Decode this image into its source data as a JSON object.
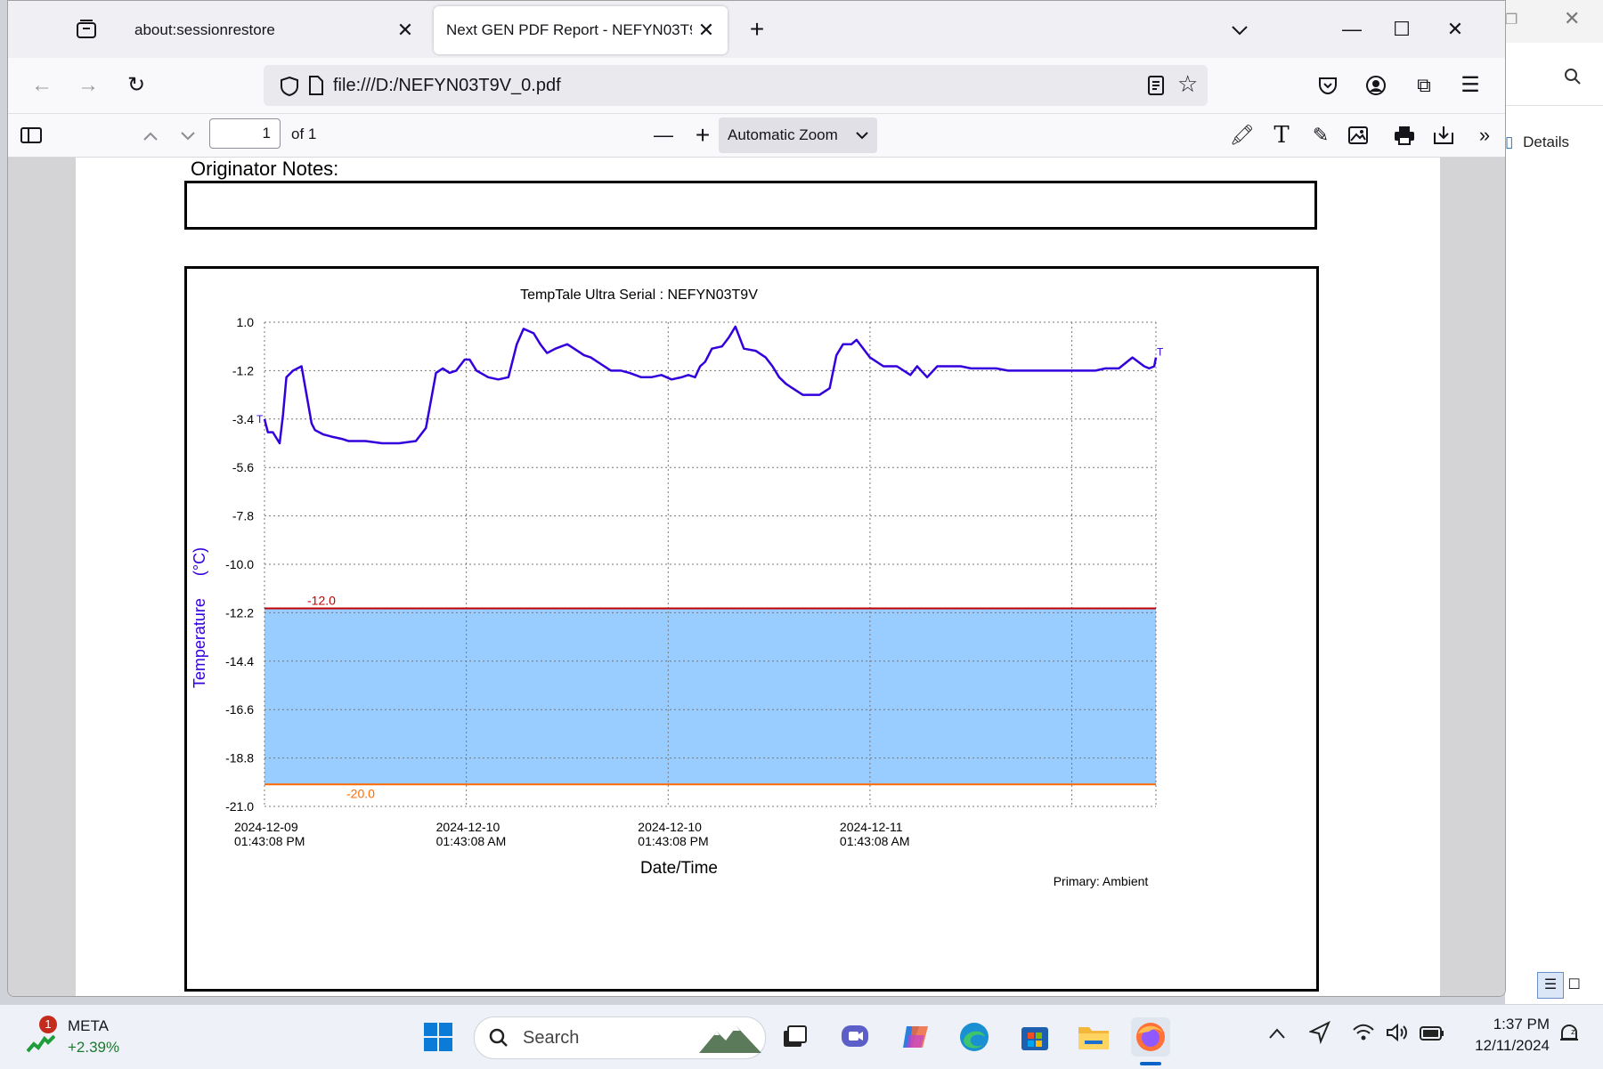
{
  "browser": {
    "tabs": [
      {
        "label": "about:sessionrestore"
      },
      {
        "label": "Next GEN PDF Report - NEFYN03T9V"
      }
    ],
    "url": "file:///D:/NEFYN03T9V_0.pdf"
  },
  "pdf_toolbar": {
    "page_number": "1",
    "page_count": "of 1",
    "zoom": "Automatic Zoom"
  },
  "background_window": {
    "details_label": "Details"
  },
  "report": {
    "notes_label": "Originator Notes:"
  },
  "chart_data": {
    "type": "line",
    "title": "TempTale Ultra  Serial : NEFYN03T9V",
    "ylabel": "Temperature     (°C)",
    "xlabel": "Date/Time",
    "ylim": [
      -21.0,
      1.0
    ],
    "yticks": [
      "1.0",
      "-1.2",
      "-3.4",
      "-5.6",
      "-7.8",
      "-10.0",
      "-12.2",
      "-14.4",
      "-16.6",
      "-18.8",
      "-21.0"
    ],
    "xticks": [
      {
        "date": "2024-12-09",
        "time": "01:43:08 PM"
      },
      {
        "date": "2024-12-10",
        "time": "01:43:08 AM"
      },
      {
        "date": "2024-12-10",
        "time": "01:43:08 PM"
      },
      {
        "date": "2024-12-11",
        "time": "01:43:08 AM"
      }
    ],
    "x_hours_per_grid": 12,
    "x_range_hours": [
      0,
      53
    ],
    "grid": true,
    "thresholds": [
      {
        "label": "-12.0",
        "value": -12.0,
        "color": "#c00000"
      },
      {
        "label": "-20.0",
        "value": -20.0,
        "color": "#ff6a00"
      }
    ],
    "band": {
      "from": -12.0,
      "to": -20.0,
      "color": "#99ccff"
    },
    "series": [
      {
        "color": "#3300dd",
        "x": [
          0,
          0.2,
          0.5,
          0.9,
          1.1,
          1.3,
          1.7,
          2.2,
          2.8,
          3.0,
          3.5,
          4.0,
          4.6,
          5.0,
          6.0,
          7.0,
          8.0,
          9.0,
          9.6,
          10.2,
          10.6,
          11.0,
          11.4,
          11.9,
          12.2,
          12.6,
          13.3,
          13.9,
          14.5,
          15.0,
          15.4,
          16.0,
          16.4,
          16.8,
          17.3,
          18.0,
          18.6,
          19.0,
          19.4,
          20.0,
          20.6,
          21.2,
          21.7,
          22.4,
          23.0,
          23.6,
          24.2,
          24.8,
          25.2,
          25.6,
          25.9,
          26.2,
          26.6,
          27.2,
          27.6,
          28.0,
          28.5,
          29.2,
          29.8,
          30.2,
          30.6,
          31.0,
          31.4,
          32.0,
          33.0,
          33.6,
          34.0,
          34.4,
          34.9,
          35.2,
          35.6,
          36.0,
          36.8,
          37.6,
          38.4,
          38.8,
          39.4,
          40.0,
          40.4,
          40.8,
          41.4,
          42.0,
          42.6,
          43.5,
          44.2,
          45.0,
          45.6,
          46.4,
          47.2,
          48.0,
          48.6,
          49.4,
          50.0,
          50.8,
          51.6,
          52.3,
          52.6,
          52.9,
          53.0
        ],
        "values": [
          -3.4,
          -4.0,
          -4.0,
          -4.5,
          -3.2,
          -1.5,
          -1.2,
          -1.0,
          -3.6,
          -3.9,
          -4.1,
          -4.2,
          -4.3,
          -4.4,
          -4.4,
          -4.5,
          -4.5,
          -4.4,
          -3.8,
          -1.3,
          -1.1,
          -1.3,
          -1.2,
          -0.7,
          -0.7,
          -1.2,
          -1.5,
          -1.6,
          -1.5,
          0.0,
          0.7,
          0.5,
          0.0,
          -0.4,
          -0.2,
          0.0,
          -0.3,
          -0.5,
          -0.6,
          -0.9,
          -1.2,
          -1.2,
          -1.3,
          -1.5,
          -1.5,
          -1.4,
          -1.6,
          -1.5,
          -1.4,
          -1.5,
          -1.0,
          -0.8,
          -0.2,
          -0.1,
          0.3,
          0.8,
          -0.2,
          -0.3,
          -0.6,
          -1.0,
          -1.5,
          -1.8,
          -2.0,
          -2.3,
          -2.3,
          -2.0,
          -0.5,
          0.0,
          0.0,
          0.2,
          -0.2,
          -0.6,
          -1.0,
          -1.0,
          -1.4,
          -1.0,
          -1.5,
          -1.0,
          -1.0,
          -1.0,
          -1.0,
          -1.1,
          -1.1,
          -1.1,
          -1.2,
          -1.2,
          -1.2,
          -1.2,
          -1.2,
          -1.2,
          -1.2,
          -1.2,
          -1.1,
          -1.1,
          -0.6,
          -1.0,
          -1.1,
          -1.0,
          -0.6
        ]
      }
    ],
    "start_marker": "T",
    "end_marker": "T",
    "footer": "Primary: Ambient"
  },
  "taskbar": {
    "stock_symbol": "META",
    "stock_change": "+2.39%",
    "badge": "1",
    "search_placeholder": "Search",
    "time": "1:37 PM",
    "date": "12/11/2024"
  },
  "colors": {
    "line": "#3300dd",
    "band": "#99ccff",
    "upper_limit": "#c00000",
    "lower_limit": "#ff6a00",
    "axis_label": "#3300dd"
  }
}
